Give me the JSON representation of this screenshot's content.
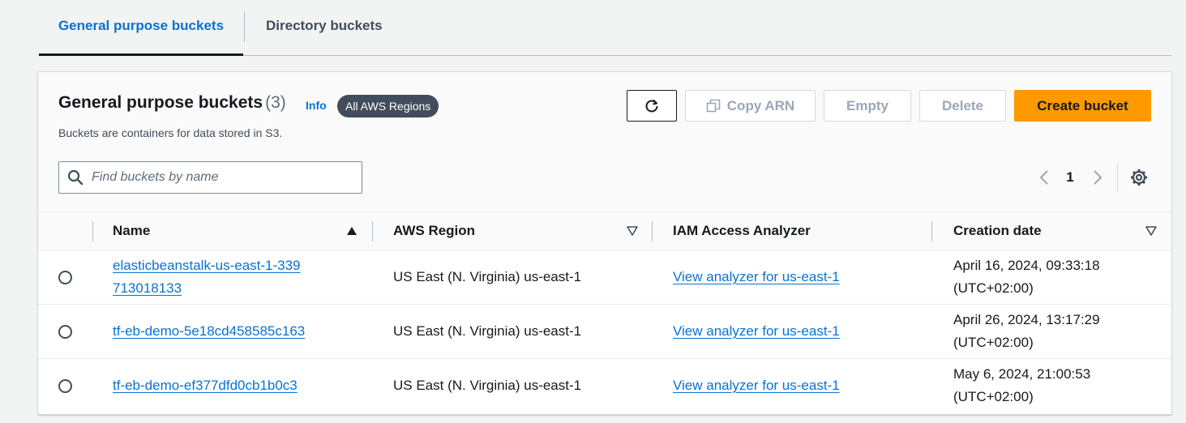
{
  "tabs": [
    {
      "label": "General purpose buckets",
      "active": true
    },
    {
      "label": "Directory buckets",
      "active": false
    }
  ],
  "panel": {
    "title": "General purpose buckets",
    "count": "(3)",
    "info": "Info",
    "region_badge": "All AWS Regions",
    "description": "Buckets are containers for data stored in S3."
  },
  "actions": {
    "refresh_icon": "refresh-icon",
    "copy_arn": "Copy ARN",
    "empty": "Empty",
    "delete": "Delete",
    "create": "Create bucket"
  },
  "search": {
    "placeholder": "Find buckets by name",
    "value": ""
  },
  "pagination": {
    "current_page": "1"
  },
  "table": {
    "columns": [
      "Name",
      "AWS Region",
      "IAM Access Analyzer",
      "Creation date"
    ],
    "rows": [
      {
        "name": "elasticbeanstalk-us-east-1-339713018133",
        "region": "US East (N. Virginia) us-east-1",
        "iam": "View analyzer for us-east-1",
        "date": "April 16, 2024, 09:33:18 (UTC+02:00)"
      },
      {
        "name": "tf-eb-demo-5e18cd458585c163",
        "region": "US East (N. Virginia) us-east-1",
        "iam": "View analyzer for us-east-1",
        "date": "April 26, 2024, 13:17:29 (UTC+02:00)"
      },
      {
        "name": "tf-eb-demo-ef377dfd0cb1b0c3",
        "region": "US East (N. Virginia) us-east-1",
        "iam": "View analyzer for us-east-1",
        "date": "May 6, 2024, 21:00:53 (UTC+02:00)"
      }
    ]
  },
  "colors": {
    "link": "#0972d3",
    "primary_button": "#ff9900",
    "badge": "#414d5c"
  }
}
